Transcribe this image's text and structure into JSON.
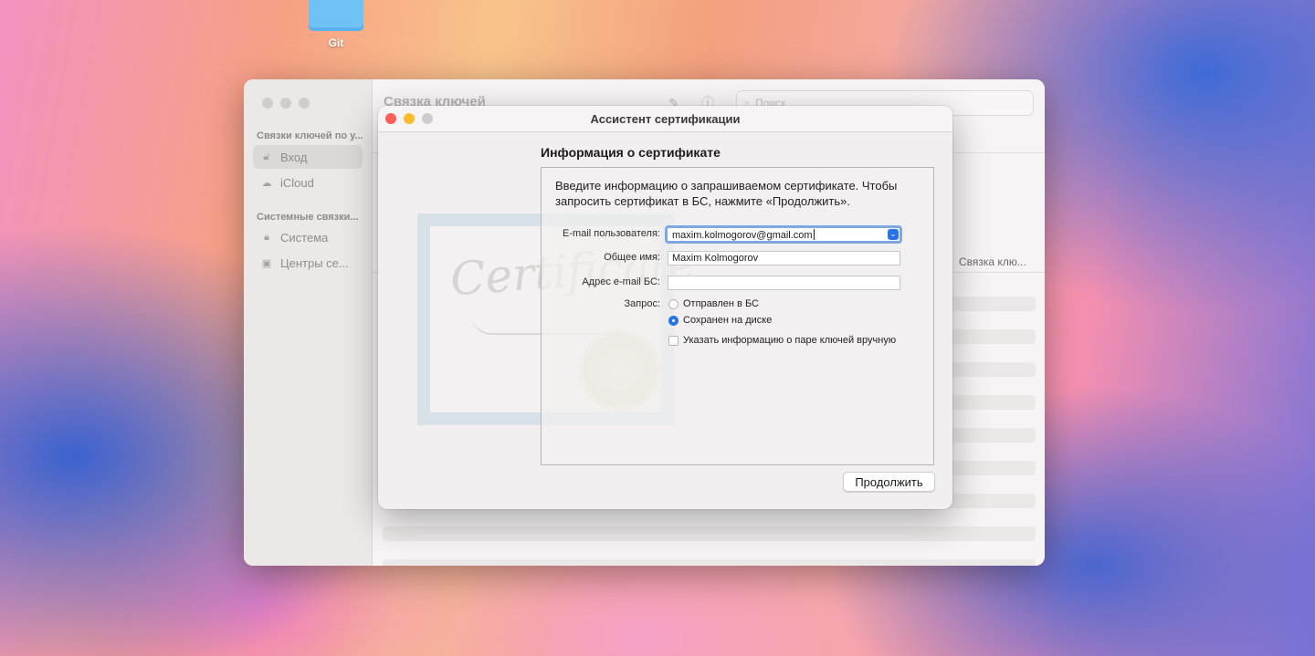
{
  "desktop": {
    "icon_label": "Git"
  },
  "keychain": {
    "title": "Связка ключей",
    "search_placeholder": "Поиск",
    "sidebar": {
      "section1": "Связки ключей по у...",
      "items1": [
        {
          "label": "Вход"
        },
        {
          "label": "iCloud"
        }
      ],
      "section2": "Системные связки...",
      "items2": [
        {
          "label": "Система"
        },
        {
          "label": "Центры се..."
        }
      ]
    },
    "column_header": "Связка клю..."
  },
  "dialog": {
    "title": "Ассистент сертификации",
    "heading": "Информация о сертификате",
    "intro": "Введите информацию о запрашиваемом сертификате. Чтобы запросить сертификат в БС, нажмите «Продолжить».",
    "cert_art_text": "Certificate",
    "labels": {
      "email": "E-mail пользователя:",
      "common_name": "Общее имя:",
      "ca_email": "Адрес e-mail БС:",
      "request": "Запрос:"
    },
    "values": {
      "email": "maxim.kolmogorov@gmail.com",
      "common_name": "Maxim Kolmogorov",
      "ca_email": ""
    },
    "options": {
      "sent_to_ca": "Отправлен в БС",
      "saved_to_disk": "Сохранен на диске",
      "selected": "saved_to_disk",
      "manual_keypair": "Указать информацию о паре ключей вручную",
      "manual_keypair_checked": false
    },
    "continue_button": "Продолжить"
  },
  "colors": {
    "accent": "#2a73e8",
    "close": "#fe5f57",
    "minimize": "#febc2e",
    "inactive": "#d0cccc"
  }
}
